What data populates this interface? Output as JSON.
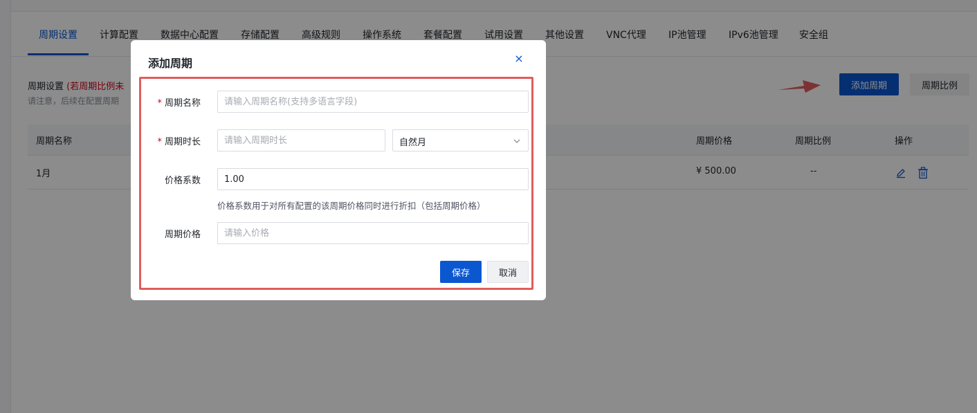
{
  "tabs": [
    {
      "label": "周期设置"
    },
    {
      "label": "计算配置"
    },
    {
      "label": "数据中心配置"
    },
    {
      "label": "存储配置"
    },
    {
      "label": "高级规则"
    },
    {
      "label": "操作系统"
    },
    {
      "label": "套餐配置"
    },
    {
      "label": "试用设置"
    },
    {
      "label": "其他设置"
    },
    {
      "label": "VNC代理"
    },
    {
      "label": "IP池管理"
    },
    {
      "label": "IPv6池管理"
    },
    {
      "label": "安全组"
    }
  ],
  "section": {
    "title": "周期设置",
    "warning_visible": "(若周期比例未",
    "note_visible": "请注意，后续在配置周期"
  },
  "toolbar": {
    "add_period_label": "添加周期",
    "period_ratio_label": "周期比例"
  },
  "table": {
    "headers": {
      "name": "周期名称",
      "price": "周期价格",
      "ratio": "周期比例",
      "actions": "操作"
    },
    "rows": [
      {
        "name": "1月",
        "price": "¥ 500.00",
        "ratio": "--"
      }
    ]
  },
  "dialog": {
    "title": "添加周期",
    "close_glyph": "×",
    "fields": {
      "name": {
        "label": "周期名称",
        "placeholder": "请输入周期名称(支持多语言字段)",
        "value": ""
      },
      "duration": {
        "label": "周期时长",
        "placeholder": "请输入周期时长",
        "value": "",
        "unit_selected": "自然月"
      },
      "coefficient": {
        "label": "价格系数",
        "value": "1.00",
        "hint": "价格系数用于对所有配置的该周期价格同时进行折扣（包括周期价格）"
      },
      "price": {
        "label": "周期价格",
        "placeholder": "请输入价格",
        "value": ""
      }
    },
    "required_mark": "*",
    "save_label": "保存",
    "cancel_label": "取消"
  },
  "colors": {
    "primary": "#0b57d0",
    "highlight_border": "#e25c5c",
    "annotation_arrow": "#e25c5c"
  }
}
